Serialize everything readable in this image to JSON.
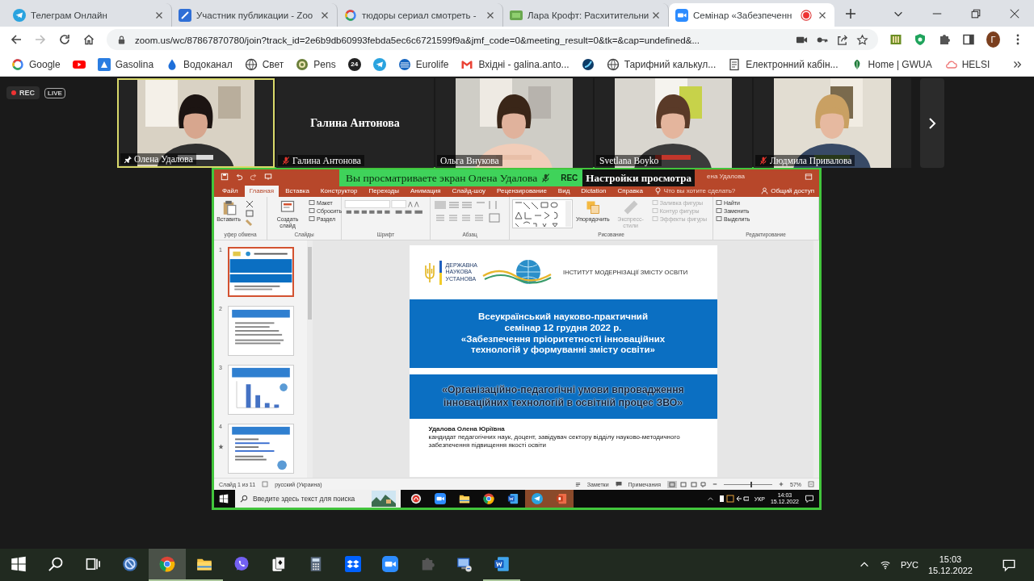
{
  "browser": {
    "tabs": [
      {
        "kind": "telegram",
        "title": "Телеграм Онлайн",
        "selected": false,
        "recording": false
      },
      {
        "kind": "zoomz",
        "title": "Участник публикации - Zoo",
        "selected": false,
        "recording": false
      },
      {
        "kind": "google",
        "title": "тюдоры сериал смотреть -",
        "selected": false,
        "recording": false
      },
      {
        "kind": "hd",
        "title": "Лара Крофт: Расхитительни",
        "selected": false,
        "recording": false
      },
      {
        "kind": "zoom",
        "title": "Семінар «Забезпеченн",
        "selected": true,
        "recording": true
      }
    ],
    "url": "zoom.us/wc/87867870780/join?track_id=2e6b9db60993febda5ec6c6721599f9a&jmf_code=0&meeting_result=0&tk=&cap=undefined&...",
    "profile": "Г",
    "bookmarks": [
      {
        "kind": "google",
        "label": "Google"
      },
      {
        "kind": "youtube"
      },
      {
        "kind": "gasolina",
        "label": "Gasolina"
      },
      {
        "kind": "drop",
        "label": "Водоканал"
      },
      {
        "kind": "globe",
        "label": "Свет"
      },
      {
        "kind": "badge",
        "label": "Pens"
      },
      {
        "kind": "round",
        "label": "24"
      },
      {
        "kind": "telegram"
      },
      {
        "kind": "stripes",
        "label": "Eurolife"
      },
      {
        "kind": "mail",
        "label": "Вхідні - galina.anto..."
      },
      {
        "kind": "sphere"
      },
      {
        "kind": "globe",
        "label": "Тарифний калькул..."
      },
      {
        "kind": "doc",
        "label": "Електронний кабін..."
      },
      {
        "kind": "leaf",
        "label": "Home | GWUA"
      },
      {
        "kind": "cloud",
        "label": "HELSI"
      }
    ]
  },
  "meeting": {
    "recording_label": "REC",
    "live_label": "LIVE",
    "participants": [
      {
        "name": "Олена Удалова",
        "speaking": true,
        "pinned": true,
        "muted": false,
        "video": true
      },
      {
        "name": "Галина Антонова",
        "speaking": false,
        "pinned": false,
        "muted": true,
        "video": false,
        "center_label": "Галина Антонова"
      },
      {
        "name": "Ольга Внукова",
        "speaking": false,
        "pinned": false,
        "muted": false,
        "video": true
      },
      {
        "name": "Svetlana Boyko",
        "speaking": false,
        "pinned": false,
        "muted": false,
        "video": true
      },
      {
        "name": "Людмила Привалова",
        "speaking": false,
        "pinned": false,
        "muted": true,
        "video": true
      }
    ]
  },
  "share_banner": {
    "text": "Вы просматриваете экран Олена Удалова",
    "rec": "REC",
    "options": "Настройки просмотра"
  },
  "ppt": {
    "window_title": "ена Удалова",
    "tabs": [
      {
        "label": "Файл",
        "selected": false
      },
      {
        "label": "Главная",
        "selected": true
      },
      {
        "label": "Вставка",
        "selected": false
      },
      {
        "label": "Конструктор",
        "selected": false
      },
      {
        "label": "Переходы",
        "selected": false
      },
      {
        "label": "Анимация",
        "selected": false
      },
      {
        "label": "Слайд-шоу",
        "selected": false
      },
      {
        "label": "Рецензирование",
        "selected": false
      },
      {
        "label": "Вид",
        "selected": false
      },
      {
        "label": "Dictation",
        "selected": false
      },
      {
        "label": "Справка",
        "selected": false
      }
    ],
    "tell_me": "Что вы хотите сделать?",
    "share": "Общий доступ",
    "groups": [
      {
        "kind": "clipboard",
        "label": "уфер обмена",
        "buttons": [
          {
            "label": "Вставить",
            "kind": "large",
            "disabled": false
          }
        ]
      },
      {
        "kind": "slides",
        "label": "Слайды",
        "buttons": [
          {
            "label": "Создать слайд",
            "kind": "large",
            "disabled": false
          },
          {
            "label": "Макет",
            "kind": "small",
            "disabled": false
          },
          {
            "label": "Сбросить",
            "kind": "small",
            "disabled": false
          },
          {
            "label": "Раздел",
            "kind": "small",
            "disabled": false
          }
        ]
      },
      {
        "kind": "font",
        "label": "Шрифт"
      },
      {
        "kind": "paragraph",
        "label": "Абзац"
      },
      {
        "kind": "drawing",
        "label": "Рисование",
        "buttons": [
          {
            "label": "Упорядочить",
            "kind": "large",
            "disabled": false
          },
          {
            "label": "Экспресс-стили",
            "kind": "large",
            "disabled": true
          },
          {
            "label": "Заливка фигуры",
            "kind": "small",
            "disabled": true
          },
          {
            "label": "Контур фигуры",
            "kind": "small",
            "disabled": true
          },
          {
            "label": "Эффекты фигуры",
            "kind": "small",
            "disabled": true
          }
        ]
      },
      {
        "kind": "editing",
        "label": "Редактирование",
        "buttons": [
          {
            "label": "Найти",
            "kind": "small",
            "disabled": false
          },
          {
            "label": "Заменить",
            "kind": "small",
            "disabled": false
          },
          {
            "label": "Выделить",
            "kind": "small",
            "disabled": false
          }
        ]
      }
    ],
    "thumbnails": [
      {
        "number": "1",
        "selected": true,
        "animated": false
      },
      {
        "number": "2",
        "selected": false,
        "animated": false
      },
      {
        "number": "3",
        "selected": false,
        "animated": false
      },
      {
        "number": "4",
        "selected": false,
        "animated": true
      }
    ],
    "slide": {
      "logo_lines": [
        "ДЕРЖАВНА",
        "НАУКОВА",
        "УСТАНОВА"
      ],
      "institute": "ІНСТИТУТ МОДЕРНІЗАЦІЇ ЗМІСТУ ОСВІТИ",
      "title_lines": [
        "Всеукраїнський науково-практичний",
        "семінар 12 грудня 2022 р.",
        "«Забезпечення пріоритетності інноваційних",
        "технологій у формуванні змісту освіти»"
      ],
      "subtitle_lines": [
        "«Організаційно-педагогічні умови впровадження",
        "інноваційних технологій в освітній процес ЗВО»"
      ],
      "author": "Удалова Олена Юріївна",
      "position": "кандидат педагогічних наук, доцент, завідувач сектору відділу науково-методичного забезпечення підвищення якості освіти"
    },
    "status": {
      "slide_counter": "Слайд 1 из 11",
      "language": "русский (Украина)",
      "notes": "Заметки",
      "comments": "Примечания",
      "zoom_slider": {
        "level": 0.55
      },
      "zoom_level": "57%"
    },
    "taskbar": {
      "search_placeholder": "Введите здесь текст для поиска",
      "apps": [
        {
          "kind": "acrobat",
          "active": false
        },
        {
          "kind": "zoom",
          "active": false
        },
        {
          "kind": "folder",
          "active": false
        },
        {
          "kind": "chrome",
          "active": false
        },
        {
          "kind": "word",
          "active": false
        },
        {
          "kind": "telegram",
          "active": true
        },
        {
          "kind": "powerpoint",
          "active": true
        }
      ],
      "language": "УКР",
      "time": "14:03",
      "date": "15.12.2022"
    }
  },
  "taskbar": {
    "apps": [
      {
        "kind": "start",
        "running": false,
        "active": false
      },
      {
        "kind": "search",
        "running": false,
        "active": false
      },
      {
        "kind": "taskview",
        "running": false,
        "active": false
      },
      {
        "kind": "rc",
        "running": false,
        "active": false
      },
      {
        "kind": "chrome",
        "running": true,
        "active": true
      },
      {
        "kind": "folder",
        "running": true,
        "active": false
      },
      {
        "kind": "viber",
        "running": false,
        "active": false
      },
      {
        "kind": "cards",
        "running": false,
        "active": false
      },
      {
        "kind": "calc",
        "running": false,
        "active": false
      },
      {
        "kind": "dropbox",
        "running": false,
        "active": false
      },
      {
        "kind": "zoom",
        "running": false,
        "active": false
      },
      {
        "kind": "puzzle",
        "running": false,
        "active": false
      },
      {
        "kind": "network",
        "running": false,
        "active": false
      },
      {
        "kind": "word",
        "running": true,
        "active": false
      }
    ],
    "language": "РУС",
    "time": "15:03",
    "date": "15.12.2022"
  }
}
